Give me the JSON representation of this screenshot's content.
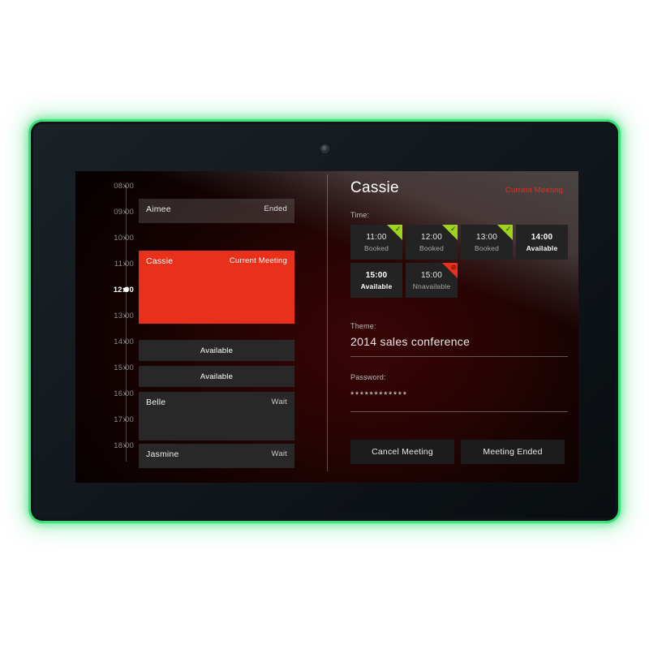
{
  "device": {
    "glow_color": "#3ee07a",
    "bezel_color": "#141a1f",
    "camera_icon": "camera-lens"
  },
  "schedule": {
    "time_axis": [
      {
        "label": "08:00",
        "current": false
      },
      {
        "label": "09:00",
        "current": false
      },
      {
        "label": "10:00",
        "current": false
      },
      {
        "label": "11:00",
        "current": false
      },
      {
        "label": "12:00",
        "current": true
      },
      {
        "label": "13:00",
        "current": false
      },
      {
        "label": "14:00",
        "current": false
      },
      {
        "label": "15:00",
        "current": false
      },
      {
        "label": "16:00",
        "current": false
      },
      {
        "label": "17:00",
        "current": false
      },
      {
        "label": "18:00",
        "current": false
      }
    ],
    "events": [
      {
        "name": "Aimee",
        "status": "Ended",
        "type": "ended"
      },
      {
        "name": "Cassie",
        "status": "Current Meeting",
        "type": "current"
      },
      {
        "name": "Belle",
        "status": "Wait",
        "type": "wait"
      },
      {
        "name": "Jasmine",
        "status": "Wait",
        "type": "wait"
      }
    ],
    "free_slots": [
      {
        "label": "Available"
      },
      {
        "label": "Available"
      }
    ]
  },
  "detail": {
    "title": "Cassie",
    "badge": "Current Meeting",
    "badge_color": "#e8301b",
    "time_label": "Time:",
    "slots": [
      {
        "time": "11:00",
        "state": "Booked",
        "mark": "booked",
        "glyph": "✓"
      },
      {
        "time": "12:00",
        "state": "Booked",
        "mark": "booked",
        "glyph": "✓"
      },
      {
        "time": "13:00",
        "state": "Booked",
        "mark": "booked",
        "glyph": "✓"
      },
      {
        "time": "14:00",
        "state": "Available",
        "mark": "none",
        "glyph": ""
      },
      {
        "time": "15:00",
        "state": "Available",
        "mark": "none",
        "glyph": ""
      },
      {
        "time": "15:00",
        "state": "Nnavailable",
        "mark": "blocked",
        "glyph": "⊘"
      }
    ],
    "theme_label": "Theme:",
    "theme_value": "2014 sales conference",
    "password_label": "Password:",
    "password_value": "************",
    "buttons": {
      "cancel": "Cancel Meeting",
      "ended": "Meeting Ended"
    }
  }
}
